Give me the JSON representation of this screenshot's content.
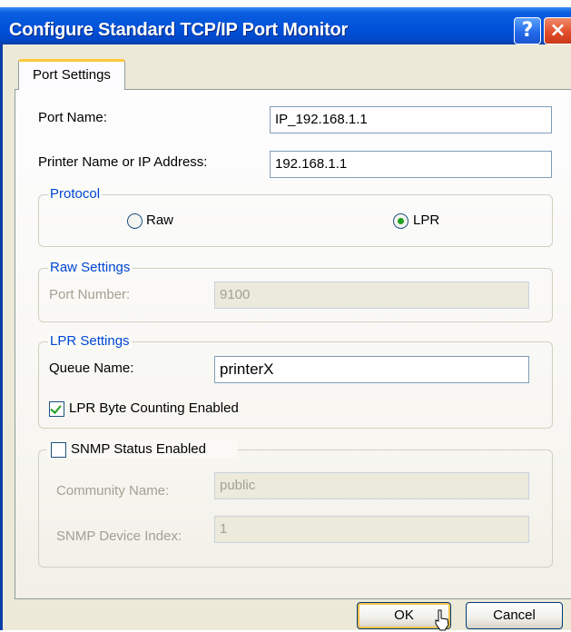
{
  "window": {
    "title": "Configure Standard TCP/IP Port Monitor",
    "help_label": "?",
    "close_label": "×"
  },
  "tabs": [
    {
      "label": "Port Settings",
      "selected": true
    }
  ],
  "port_name": {
    "label": "Port Name:",
    "value": "IP_192.168.1.1"
  },
  "printer_name": {
    "label": "Printer Name or IP Address:",
    "value": "192.168.1.1"
  },
  "protocol": {
    "title": "Protocol",
    "options": [
      {
        "label": "Raw",
        "selected": false
      },
      {
        "label": "LPR",
        "selected": true
      }
    ]
  },
  "raw_settings": {
    "title": "Raw Settings",
    "port_number_label": "Port Number:",
    "port_number_value": "9100",
    "enabled": false
  },
  "lpr_settings": {
    "title": "LPR Settings",
    "queue_name_label": "Queue Name:",
    "queue_name_value": "printerX",
    "byte_counting_label": "LPR Byte Counting Enabled",
    "byte_counting_checked": true
  },
  "snmp": {
    "title": "SNMP Status Enabled",
    "checked": false,
    "community_label": "Community Name:",
    "community_value": "public",
    "device_index_label": "SNMP Device Index:",
    "device_index_value": "1"
  },
  "buttons": {
    "ok": "OK",
    "cancel": "Cancel"
  },
  "colors": {
    "titlebar": "#0050d8",
    "group_title": "#0046d5",
    "check_green": "#21a121",
    "disabled_text": "#a3a192"
  }
}
